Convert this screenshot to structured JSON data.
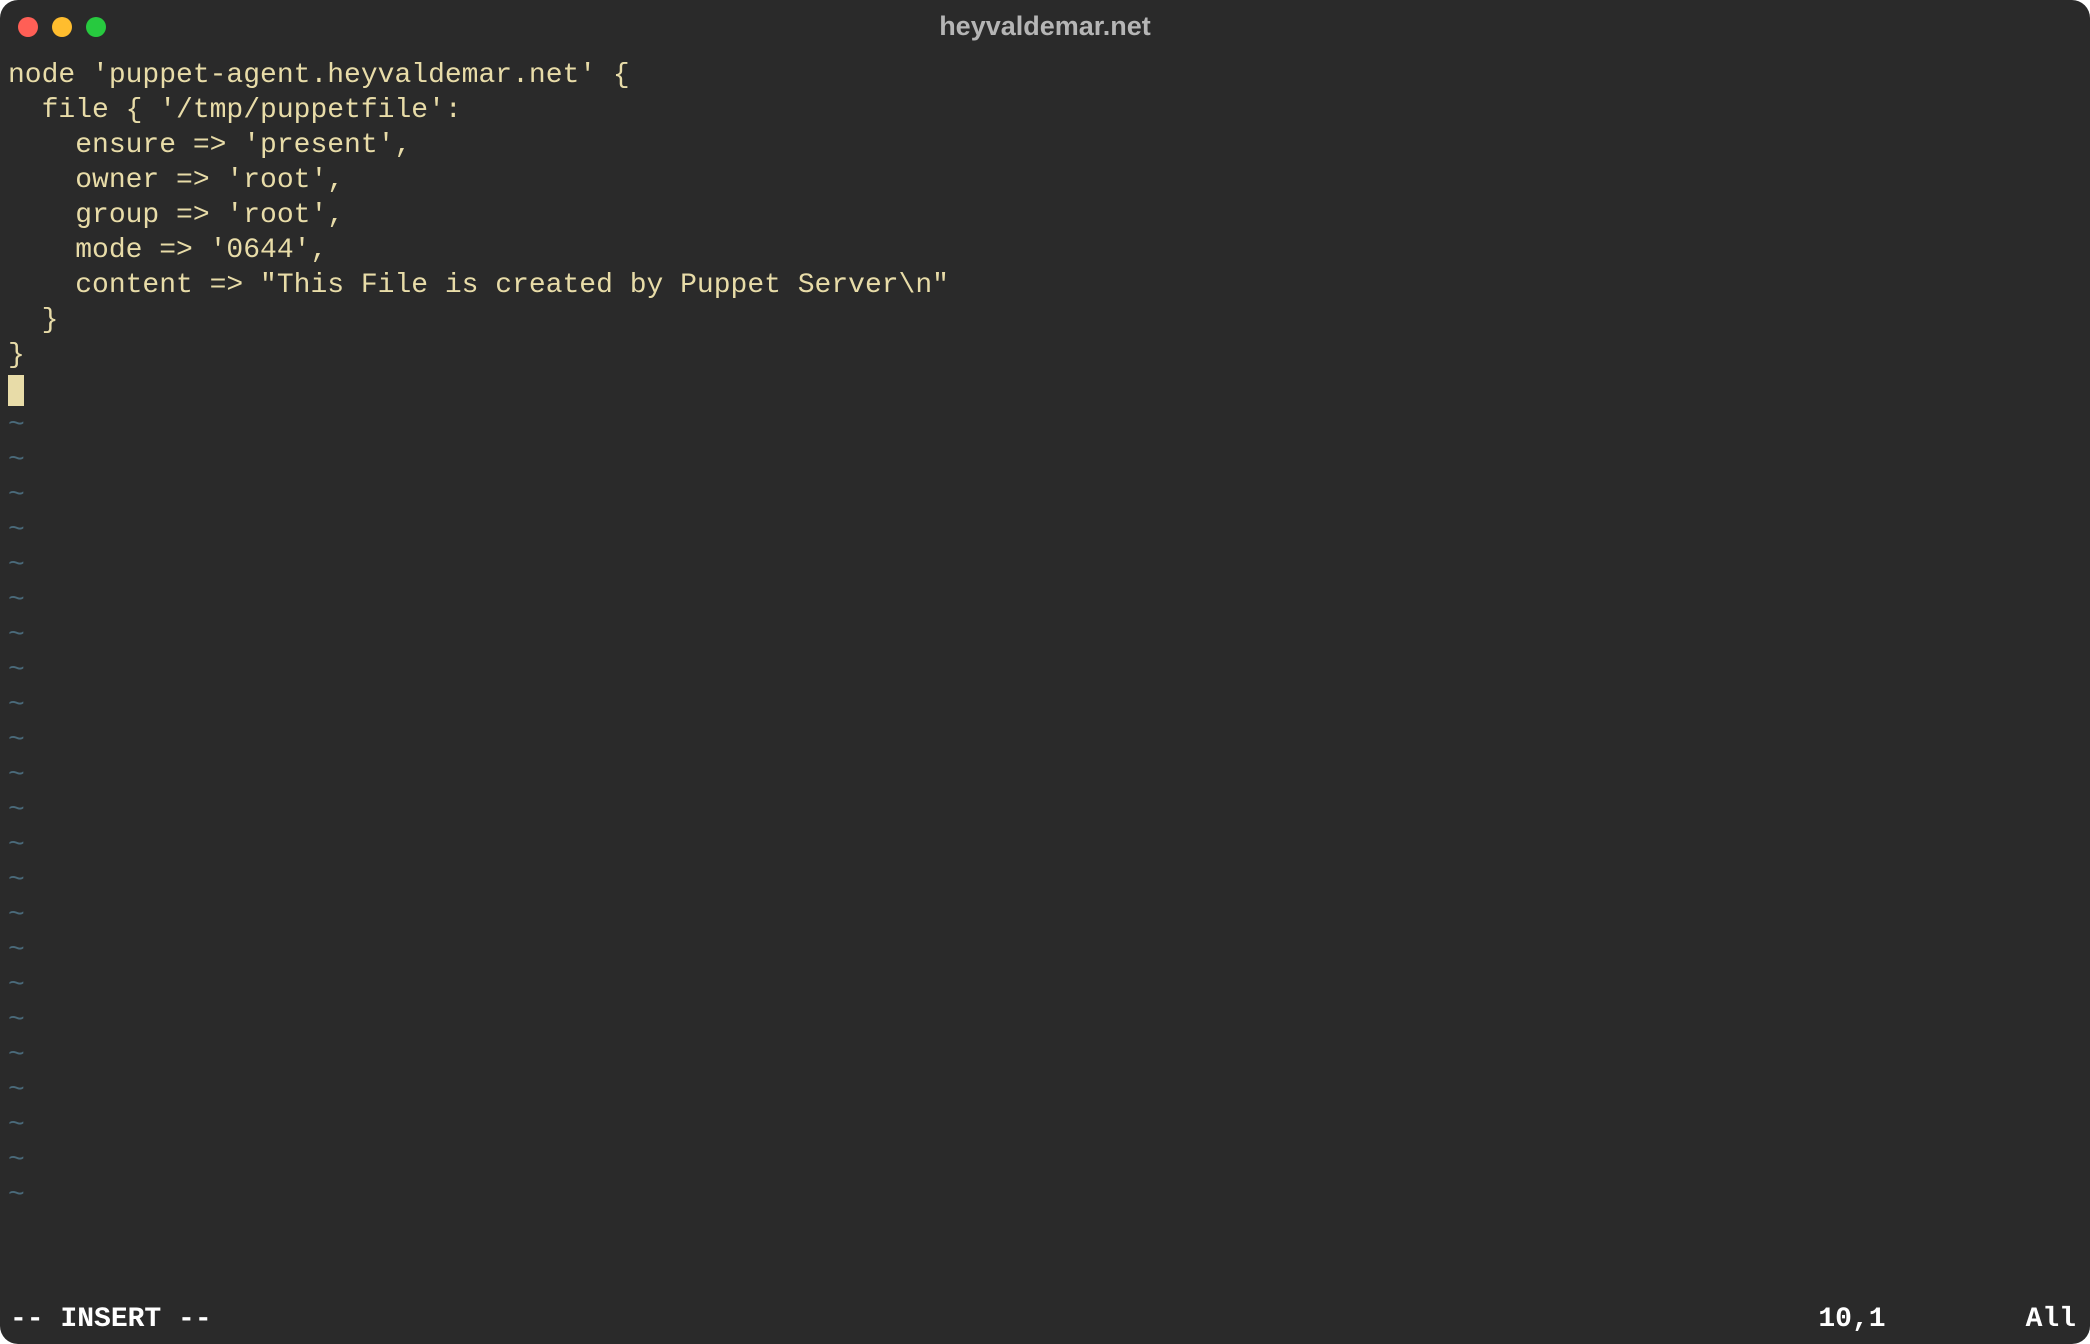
{
  "window": {
    "title": "heyvaldemar.net"
  },
  "editor": {
    "lines": [
      "node 'puppet-agent.heyvaldemar.net' {",
      "  file { '/tmp/puppetfile':",
      "    ensure => 'present',",
      "    owner => 'root',",
      "    group => 'root',",
      "    mode => '0644',",
      "    content => \"This File is created by Puppet Server\\n\"",
      "  }",
      "}"
    ],
    "tilde_char": "~",
    "tilde_rows": 23
  },
  "status": {
    "mode": "-- INSERT --",
    "position": "10,1",
    "scroll": "All"
  }
}
